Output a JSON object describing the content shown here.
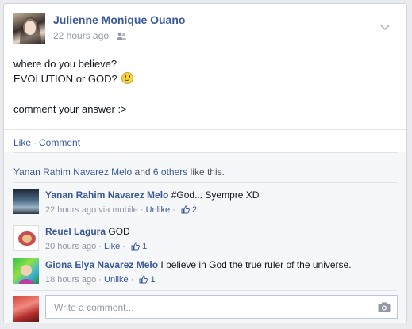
{
  "post": {
    "author": "Julienne Monique Ouano",
    "timestamp": "22 hours ago",
    "privacy_icon": "friends-icon",
    "lines": [
      "where do you believe?",
      "EVOLUTION or GOD?",
      "",
      "comment your answer :>"
    ],
    "emoticon": "smiley-icon"
  },
  "actions": {
    "like": "Like",
    "separator": "·",
    "comment": "Comment"
  },
  "likes": {
    "name": "Yanan Rahim Navarez Melo",
    "and": "and",
    "others": "6 others",
    "suffix": "like this."
  },
  "comments": [
    {
      "name": "Yanan Rahim Navarez Melo",
      "text": "#God... Syempre XD",
      "time": "22 hours ago",
      "via": "via mobile",
      "sep": "·",
      "action": "Unlike",
      "likes": "2"
    },
    {
      "name": "Reuel Lagura",
      "text": "GOD",
      "time": "20 hours ago",
      "sep": "·",
      "action": "Like",
      "likes": "1"
    },
    {
      "name": "Giona Elya Navarez Melo",
      "text": "I believe in God the true ruler of the universe.",
      "time": "18 hours ago",
      "sep": "·",
      "action": "Unlike",
      "likes": "1"
    }
  ],
  "composer": {
    "placeholder": "Write a comment...",
    "camera_icon": "camera-icon"
  },
  "colors": {
    "link": "#3b5998",
    "meta": "#9197a3",
    "ufi_bg": "#f6f7f9"
  }
}
